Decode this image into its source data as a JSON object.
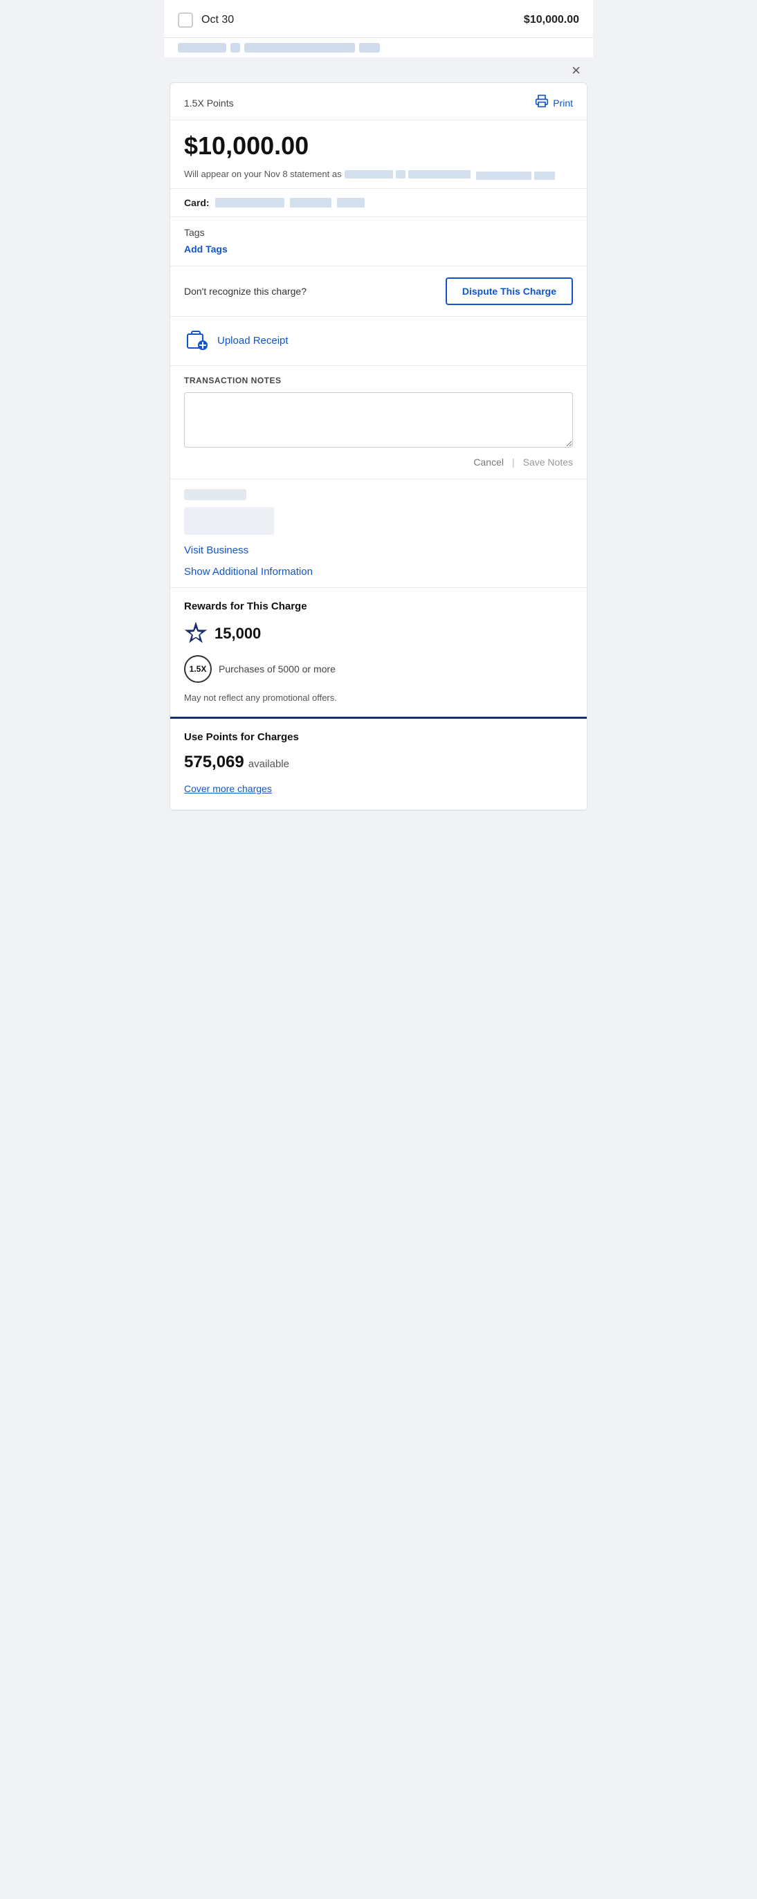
{
  "header": {
    "date": "Oct 30",
    "amount": "$10,000.00",
    "checkbox_label": "select transaction"
  },
  "close_button": "×",
  "detail": {
    "points_label": "1.5X Points",
    "print_label": "Print",
    "main_amount": "$10,000.00",
    "statement_text": "Will appear on your Nov 8 statement as",
    "card_label": "Card:",
    "tags_title": "Tags",
    "add_tags_label": "Add Tags",
    "dispute_question": "Don't recognize this charge?",
    "dispute_button": "Dispute This Charge",
    "upload_label": "Upload Receipt",
    "notes_title": "TRANSACTION NOTES",
    "notes_placeholder": "",
    "cancel_label": "Cancel",
    "save_notes_label": "Save Notes",
    "visit_business_label": "Visit Business",
    "show_additional_label": "Show Additional Information",
    "rewards_title": "Rewards for This Charge",
    "rewards_points": "15,000",
    "multiplier_badge": "1.5X",
    "purchases_text": "Purchases of 5000 or more",
    "rewards_note": "May not reflect any promotional offers.",
    "use_points_title": "Use Points for Charges",
    "available_points": "575,069",
    "available_label": "available",
    "cover_charges_label": "Cover more charges"
  }
}
